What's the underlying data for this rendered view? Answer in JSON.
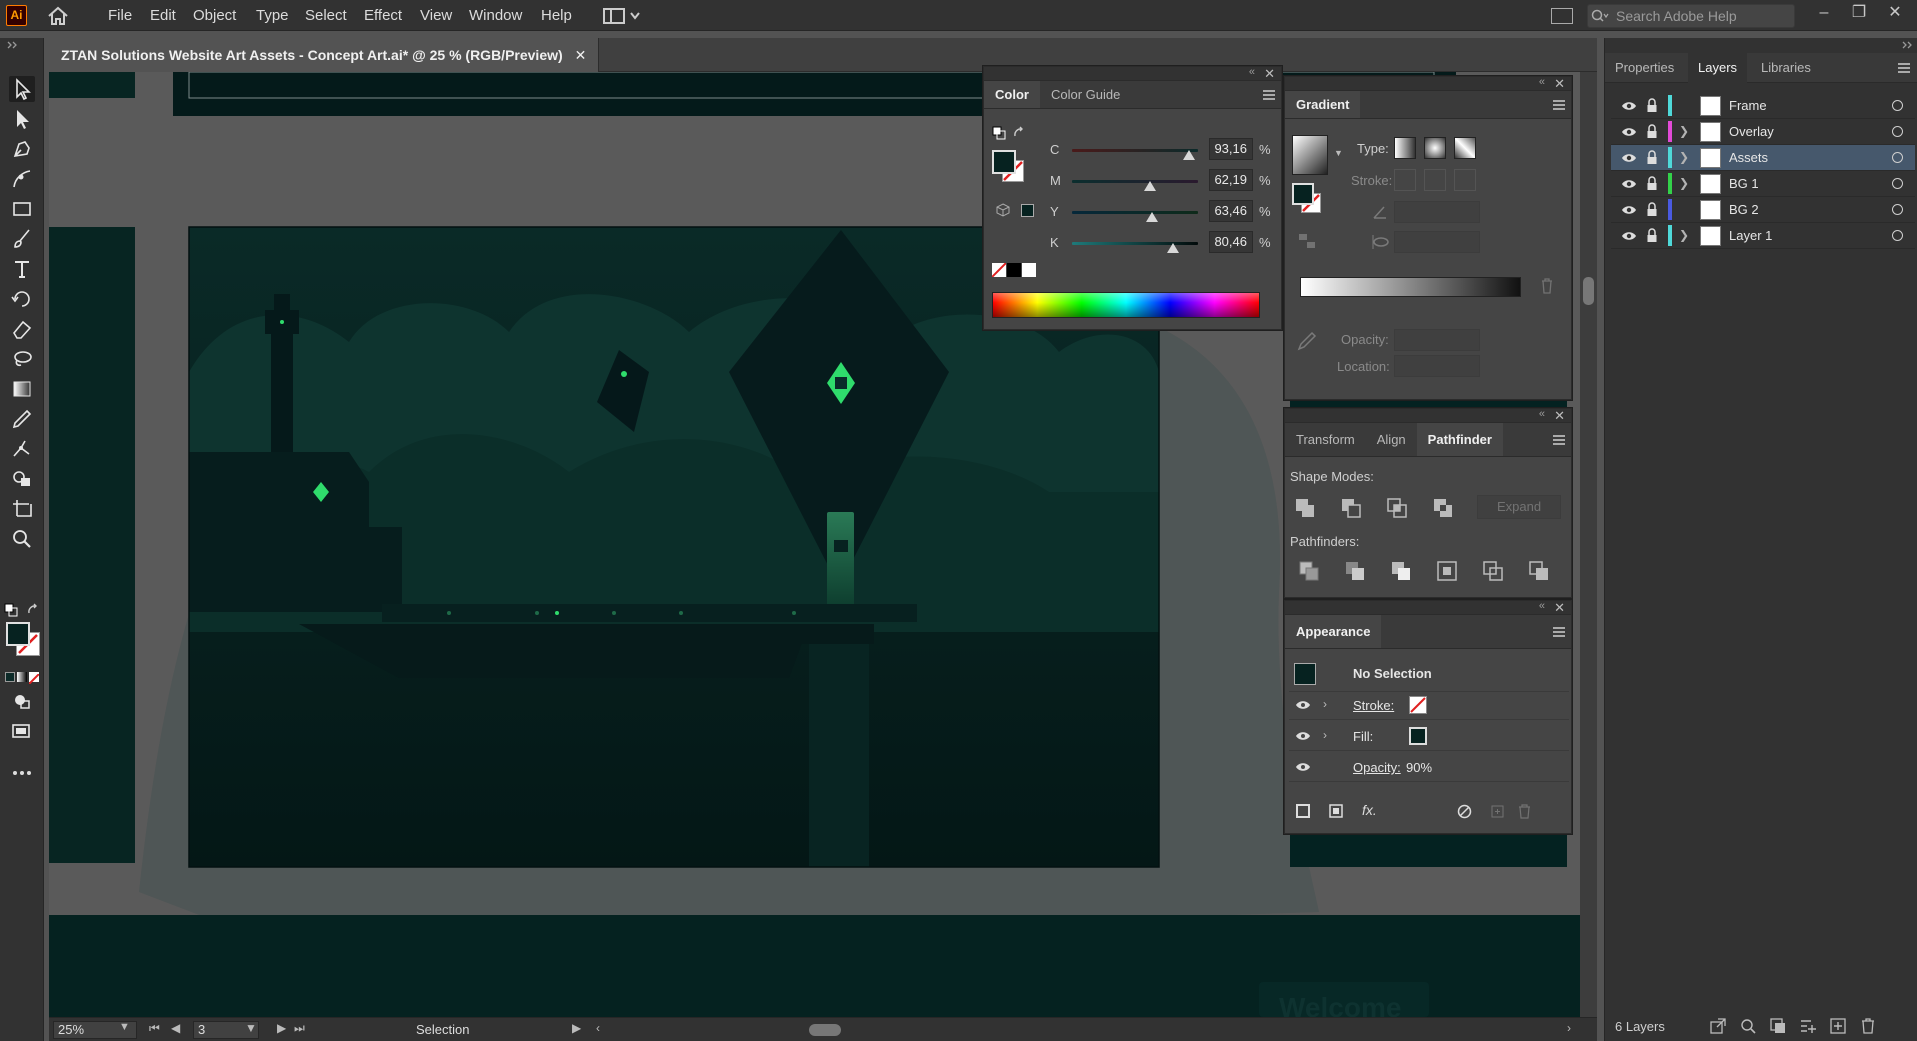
{
  "app": {
    "logo": "Ai",
    "home_icon": "home-icon"
  },
  "menu": [
    "File",
    "Edit",
    "Object",
    "Type",
    "Select",
    "Effect",
    "View",
    "Window",
    "Help"
  ],
  "search": {
    "placeholder": "Search Adobe Help"
  },
  "window_controls": [
    "–",
    "❐",
    "✕"
  ],
  "document": {
    "tab_title": "ZTAN Solutions Website Art Assets  - Concept Art.ai* @ 25 % (RGB/Preview)",
    "close_label": "✕"
  },
  "artwork": {
    "welcome_text": "Welcome",
    "colors": {
      "bg": "#06201e",
      "mid": "#0c302b",
      "hill": "#123a35",
      "dark": "#04141a",
      "accent": "#2fdc6c",
      "pasteboard": "#5a5a5a"
    }
  },
  "color_panel": {
    "tabs": [
      "Color",
      "Color Guide"
    ],
    "channels": [
      {
        "label": "C",
        "value": "93,16",
        "fraction": 0.9316
      },
      {
        "label": "M",
        "value": "62,19",
        "fraction": 0.6219
      },
      {
        "label": "Y",
        "value": "63,46",
        "fraction": 0.6346
      },
      {
        "label": "K",
        "value": "80,46",
        "fraction": 0.8046
      }
    ],
    "unit": "%",
    "fill_color": "#062220"
  },
  "gradient_panel": {
    "title": "Gradient",
    "type_label": "Type:",
    "stroke_label": "Stroke:",
    "opacity_label": "Opacity:",
    "location_label": "Location:"
  },
  "pathfinder_panel": {
    "tabs": [
      "Transform",
      "Align",
      "Pathfinder"
    ],
    "shape_modes_label": "Shape Modes:",
    "expand_label": "Expand",
    "pathfinders_label": "Pathfinders:"
  },
  "appearance_panel": {
    "title": "Appearance",
    "selection": "No Selection",
    "stroke_label": "Stroke:",
    "fill_label": "Fill:",
    "opacity_label": "Opacity:",
    "opacity_value": "90%",
    "fx_label": "fx."
  },
  "right_dock": {
    "tabs": [
      "Properties",
      "Layers",
      "Libraries"
    ],
    "active_tab": "Layers",
    "layers": [
      {
        "name": "Frame",
        "color": "#4fd9d9",
        "expandable": false,
        "selected": false
      },
      {
        "name": "Overlay",
        "color": "#e24ad6",
        "expandable": true,
        "selected": false
      },
      {
        "name": "Assets",
        "color": "#4fd9d9",
        "expandable": true,
        "selected": true
      },
      {
        "name": "BG 1",
        "color": "#33d24a",
        "expandable": true,
        "selected": false
      },
      {
        "name": "BG 2",
        "color": "#4a5ae0",
        "expandable": false,
        "selected": false
      },
      {
        "name": "Layer 1",
        "color": "#4fd9d9",
        "expandable": true,
        "selected": false
      }
    ],
    "layers_count": "6 Layers"
  },
  "status_bar": {
    "zoom": "25%",
    "page": "3",
    "tool": "Selection"
  }
}
